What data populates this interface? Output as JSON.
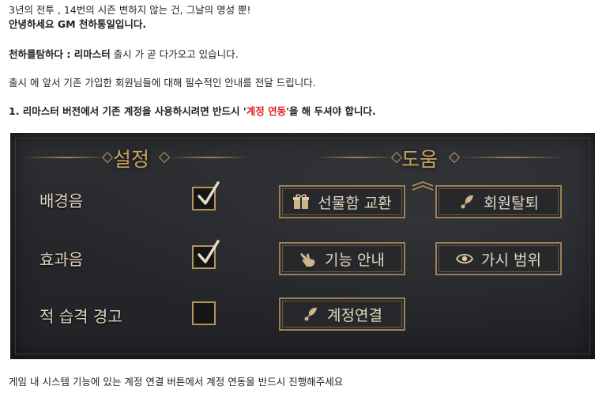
{
  "intro": {
    "line1": "3년의 전투 , 14번의 시즌 변하지 않는 건, 그날의 명성 뿐!",
    "line2": "안녕하세요 GM 천하통일입니다.",
    "line3_bold": "천하를탐하다 : 리마스터",
    "line3_rest": " 출시 가 곧 다가오고 있습니다.",
    "line4": "출시 에 앞서 기존 가입한 회원님들에 대해 필수적인 안내를 전달 드립니다.",
    "notice_part1": "1. 리마스터 버전에서 기존 계정을 사용하시려면 반드시 '",
    "notice_highlight": "계정 연동",
    "notice_part2": "'을 해 두셔야 합니다."
  },
  "game_panel": {
    "settings_title": "설정",
    "help_title": "도움",
    "settings": [
      {
        "label": "배경음",
        "checked": true
      },
      {
        "label": "효과음",
        "checked": true
      },
      {
        "label": "적 습격 경고",
        "checked": false
      }
    ],
    "buttons": {
      "gift_exchange": {
        "label": "선물함 교환",
        "icon": "gift-icon"
      },
      "withdraw": {
        "label": "회원탈퇴",
        "icon": "quill-icon"
      },
      "guide": {
        "label": "기능 안내",
        "icon": "hand-pointer-icon"
      },
      "view_range": {
        "label": "가시 범위",
        "icon": "eye-icon"
      },
      "link_account": {
        "label": "계정연결",
        "icon": "quill-icon"
      }
    }
  },
  "footer": {
    "text": "게임 내 시스템 기능에 있는 계정 연결 버튼에서 계정 연동을 반드시 진행해주세요"
  },
  "colors": {
    "highlight_red": "#e02020",
    "panel_bg": "#26282c",
    "gold": "#c9a45f"
  }
}
